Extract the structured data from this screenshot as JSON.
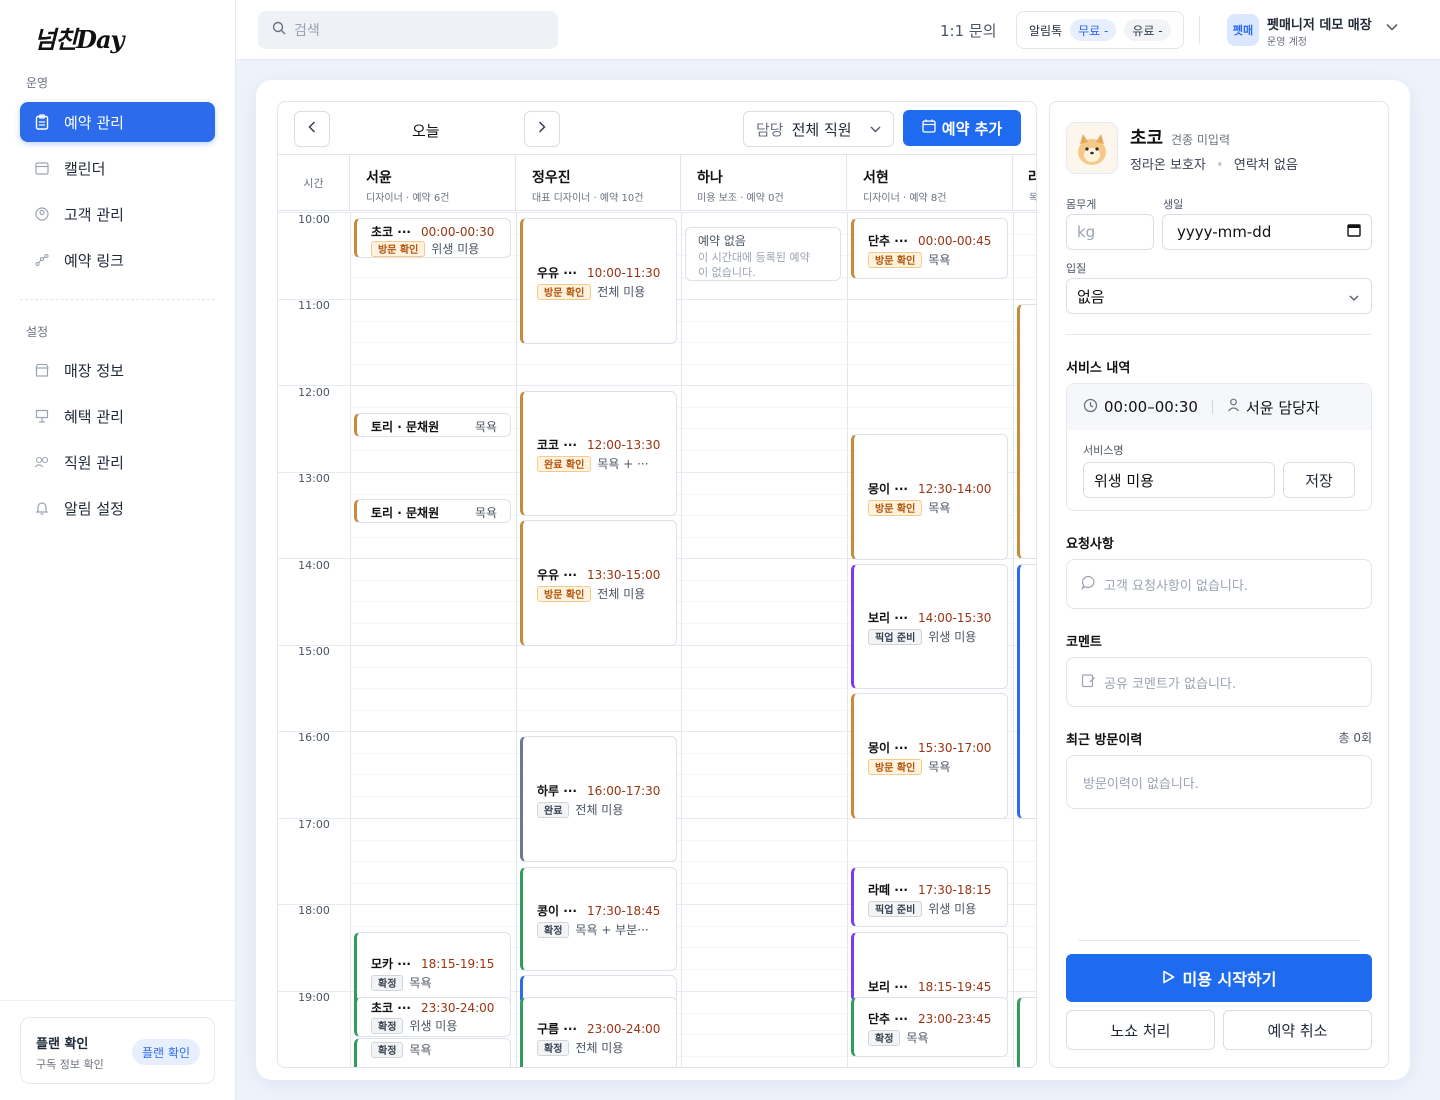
{
  "app": {
    "logo": "넘친Day"
  },
  "sidebar": {
    "section_ops": "운영",
    "section_settings": "설정",
    "items_ops": [
      {
        "label": "예약 관리",
        "icon": "clipboard-icon",
        "active": true
      },
      {
        "label": "캘린더",
        "icon": "calendar-icon"
      },
      {
        "label": "고객 관리",
        "icon": "user-circle-icon"
      },
      {
        "label": "예약 링크",
        "icon": "link-graph-icon"
      }
    ],
    "items_settings": [
      {
        "label": "매장 정보",
        "icon": "store-icon"
      },
      {
        "label": "혜택 관리",
        "icon": "gift-sign-icon"
      },
      {
        "label": "직원 관리",
        "icon": "staff-icon"
      },
      {
        "label": "알림 설정",
        "icon": "bell-icon"
      }
    ],
    "plan": {
      "title": "플랜 확인",
      "sub": "구독 정보 확인",
      "button": "플랜 확인"
    }
  },
  "topbar": {
    "search_placeholder": "검색",
    "inquiry": "1:1 문의",
    "alimtalk": "알림톡",
    "free": "무료 -",
    "paid": "유료 -",
    "store_avatar": "펫매",
    "store_name": "펫매니저 데모 매장",
    "store_sub": "운영 계정"
  },
  "calendar": {
    "today": "오늘",
    "staff_label": "담당",
    "staff_value": "전체 직원",
    "add_button": "예약 추가",
    "time_header": "시간",
    "staff": [
      {
        "name": "서윤",
        "sub": "디자이너 · 예약 6건"
      },
      {
        "name": "정우진",
        "sub": "대표 디자이너 · 예약 10건"
      },
      {
        "name": "하나",
        "sub": "미용 보조 · 예약 0건"
      },
      {
        "name": "서현",
        "sub": "디자이너 · 예약 8건"
      },
      {
        "name": "라",
        "sub": "목"
      }
    ],
    "times": [
      "10:00",
      "11:00",
      "12:00",
      "13:00",
      "14:00",
      "15:00",
      "16:00",
      "17:00",
      "18:00",
      "19:00"
    ],
    "empty": {
      "title": "예약 없음",
      "desc": "이 시간대에 등록된 예약이 없습니다."
    },
    "appointments": [
      {
        "col": 0,
        "pet": "초코 ···",
        "time": "00:00-00:30",
        "badge": "방문 확인",
        "service": "위생 미용"
      },
      {
        "col": 0,
        "pet": "토리 · 문채원",
        "time": "",
        "badge": "",
        "service": "목욕"
      },
      {
        "col": 0,
        "pet": "토리 · 문채원",
        "time": "",
        "badge": "",
        "service": "목욕"
      },
      {
        "col": 0,
        "pet": "모카 ···",
        "time": "18:15-19:15",
        "badge": "확정",
        "service": "목욕"
      },
      {
        "col": 0,
        "pet": "초코 ···",
        "time": "23:30-24:00",
        "badge": "확정",
        "service": "위생 미용"
      },
      {
        "col": 0,
        "pet": "",
        "time": "",
        "badge": "확정",
        "service": "목욕"
      },
      {
        "col": 1,
        "pet": "우유 ···",
        "time": "10:00-11:30",
        "badge": "방문 확인",
        "service": "전체 미용"
      },
      {
        "col": 1,
        "pet": "코코 ···",
        "time": "12:00-13:30",
        "badge": "완료 확인",
        "service": "목욕 + ···"
      },
      {
        "col": 1,
        "pet": "우유 ···",
        "time": "13:30-15:00",
        "badge": "방문 확인",
        "service": "전체 미용"
      },
      {
        "col": 1,
        "pet": "하루 ···",
        "time": "16:00-17:30",
        "badge": "완료",
        "service": "전체 미용"
      },
      {
        "col": 1,
        "pet": "콩이 ···",
        "time": "17:30-18:45",
        "badge": "확정",
        "service": "목욕 + 부분···"
      },
      {
        "col": 1,
        "pet": "구름 ···",
        "time": "23:00-24:00",
        "badge": "확정",
        "service": "전체 미용"
      },
      {
        "col": 3,
        "pet": "단추 ···",
        "time": "00:00-00:45",
        "badge": "방문 확인",
        "service": "목욕"
      },
      {
        "col": 3,
        "pet": "몽이 ···",
        "time": "12:30-14:00",
        "badge": "방문 확인",
        "service": "목욕"
      },
      {
        "col": 3,
        "pet": "보리 ···",
        "time": "14:00-15:30",
        "badge": "픽업 준비",
        "service": "위생 미용"
      },
      {
        "col": 3,
        "pet": "몽이 ···",
        "time": "15:30-17:00",
        "badge": "방문 확인",
        "service": "목욕"
      },
      {
        "col": 3,
        "pet": "라떼 ···",
        "time": "17:30-18:15",
        "badge": "픽업 준비",
        "service": "위생 미용"
      },
      {
        "col": 3,
        "pet": "보리 ···",
        "time": "18:15-19:45",
        "badge": "",
        "service": ""
      },
      {
        "col": 3,
        "pet": "단추 ···",
        "time": "23:00-23:45",
        "badge": "확정",
        "service": "목욕"
      }
    ]
  },
  "detail": {
    "pet_name": "초코",
    "breed": "견종 미입력",
    "owner": "정라온 보호자",
    "contact": "연락처 없음",
    "weight_label": "몸무게",
    "weight_placeholder": "kg",
    "birthday_label": "생일",
    "birthday_placeholder": "yyyy-mm-dd",
    "coat_label": "입질",
    "coat_value": "없음",
    "service_title": "서비스 내역",
    "service_time": "00:00–00:30",
    "service_staff": "서윤 담당자",
    "service_name_label": "서비스명",
    "service_name": "위생 미용",
    "save": "저장",
    "request_title": "요청사항",
    "request_empty": "고객 요청사항이 없습니다.",
    "comment_title": "코멘트",
    "comment_empty": "공유 코멘트가 없습니다.",
    "history_title": "최근 방문이력",
    "history_total": "총 0회",
    "history_empty": "방문이력이 없습니다.",
    "start_button": "미용 시작하기",
    "noshow_button": "노쇼 처리",
    "cancel_button": "예약 취소"
  }
}
